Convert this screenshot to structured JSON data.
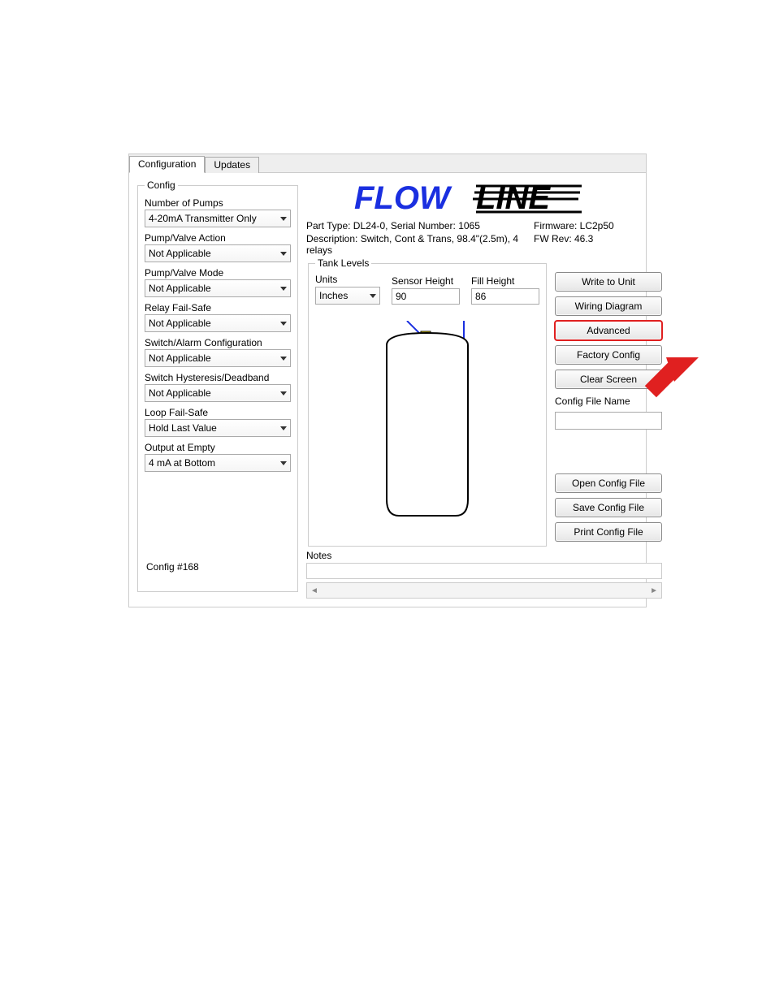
{
  "tabs": {
    "configuration": "Configuration",
    "updates": "Updates"
  },
  "config_panel": {
    "legend": "Config",
    "fields": {
      "num_pumps": {
        "label": "Number of Pumps",
        "value": "4-20mA Transmitter Only"
      },
      "pump_valve_action": {
        "label": "Pump/Valve Action",
        "value": "Not Applicable"
      },
      "pump_valve_mode": {
        "label": "Pump/Valve Mode",
        "value": "Not Applicable"
      },
      "relay_fail_safe": {
        "label": "Relay Fail-Safe",
        "value": "Not Applicable"
      },
      "switch_alarm_cfg": {
        "label": "Switch/Alarm Configuration",
        "value": "Not Applicable"
      },
      "switch_hyst": {
        "label": "Switch Hysteresis/Deadband",
        "value": "Not Applicable"
      },
      "loop_fail_safe": {
        "label": "Loop Fail-Safe",
        "value": "Hold Last Value"
      },
      "output_empty": {
        "label": "Output at Empty",
        "value": "4 mA at Bottom"
      }
    },
    "config_number": "Config #168"
  },
  "header_info": {
    "part_serial": "Part Type: DL24-0, Serial Number: 1065",
    "firmware": "Firmware: LC2p50",
    "description": "Description: Switch, Cont & Trans, 98.4\"(2.5m), 4 relays",
    "fw_rev": "FW Rev: 46.3"
  },
  "tank_levels": {
    "legend": "Tank Levels",
    "units_label": "Units",
    "units_value": "Inches",
    "sensor_height_label": "Sensor Height",
    "sensor_height_value": "90",
    "fill_height_label": "Fill Height",
    "fill_height_value": "86"
  },
  "buttons": {
    "write_to_unit": "Write to Unit",
    "wiring_diagram": "Wiring Diagram",
    "advanced": "Advanced",
    "factory_config": "Factory Config",
    "clear_screen": "Clear Screen",
    "cfg_file_label": "Config File Name",
    "open_cfg": "Open Config File",
    "save_cfg": "Save Config File",
    "print_cfg": "Print Config File"
  },
  "notes": {
    "label": "Notes",
    "scroll_left": "◄",
    "scroll_right": "►"
  }
}
